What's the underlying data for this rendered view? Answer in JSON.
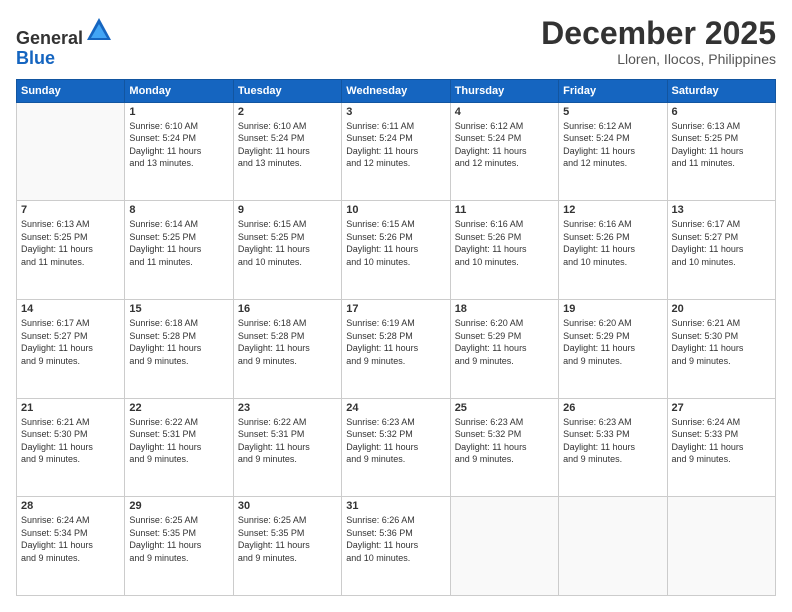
{
  "header": {
    "logo_general": "General",
    "logo_blue": "Blue",
    "month_title": "December 2025",
    "location": "Lloren, Ilocos, Philippines"
  },
  "days_of_week": [
    "Sunday",
    "Monday",
    "Tuesday",
    "Wednesday",
    "Thursday",
    "Friday",
    "Saturday"
  ],
  "weeks": [
    [
      {
        "day": "",
        "sunrise": "",
        "sunset": "",
        "daylight": ""
      },
      {
        "day": "1",
        "sunrise": "Sunrise: 6:10 AM",
        "sunset": "Sunset: 5:24 PM",
        "daylight": "Daylight: 11 hours and 13 minutes."
      },
      {
        "day": "2",
        "sunrise": "Sunrise: 6:10 AM",
        "sunset": "Sunset: 5:24 PM",
        "daylight": "Daylight: 11 hours and 13 minutes."
      },
      {
        "day": "3",
        "sunrise": "Sunrise: 6:11 AM",
        "sunset": "Sunset: 5:24 PM",
        "daylight": "Daylight: 11 hours and 12 minutes."
      },
      {
        "day": "4",
        "sunrise": "Sunrise: 6:12 AM",
        "sunset": "Sunset: 5:24 PM",
        "daylight": "Daylight: 11 hours and 12 minutes."
      },
      {
        "day": "5",
        "sunrise": "Sunrise: 6:12 AM",
        "sunset": "Sunset: 5:24 PM",
        "daylight": "Daylight: 11 hours and 12 minutes."
      },
      {
        "day": "6",
        "sunrise": "Sunrise: 6:13 AM",
        "sunset": "Sunset: 5:25 PM",
        "daylight": "Daylight: 11 hours and 11 minutes."
      }
    ],
    [
      {
        "day": "7",
        "sunrise": "Sunrise: 6:13 AM",
        "sunset": "Sunset: 5:25 PM",
        "daylight": "Daylight: 11 hours and 11 minutes."
      },
      {
        "day": "8",
        "sunrise": "Sunrise: 6:14 AM",
        "sunset": "Sunset: 5:25 PM",
        "daylight": "Daylight: 11 hours and 11 minutes."
      },
      {
        "day": "9",
        "sunrise": "Sunrise: 6:15 AM",
        "sunset": "Sunset: 5:25 PM",
        "daylight": "Daylight: 11 hours and 10 minutes."
      },
      {
        "day": "10",
        "sunrise": "Sunrise: 6:15 AM",
        "sunset": "Sunset: 5:26 PM",
        "daylight": "Daylight: 11 hours and 10 minutes."
      },
      {
        "day": "11",
        "sunrise": "Sunrise: 6:16 AM",
        "sunset": "Sunset: 5:26 PM",
        "daylight": "Daylight: 11 hours and 10 minutes."
      },
      {
        "day": "12",
        "sunrise": "Sunrise: 6:16 AM",
        "sunset": "Sunset: 5:26 PM",
        "daylight": "Daylight: 11 hours and 10 minutes."
      },
      {
        "day": "13",
        "sunrise": "Sunrise: 6:17 AM",
        "sunset": "Sunset: 5:27 PM",
        "daylight": "Daylight: 11 hours and 10 minutes."
      }
    ],
    [
      {
        "day": "14",
        "sunrise": "Sunrise: 6:17 AM",
        "sunset": "Sunset: 5:27 PM",
        "daylight": "Daylight: 11 hours and 9 minutes."
      },
      {
        "day": "15",
        "sunrise": "Sunrise: 6:18 AM",
        "sunset": "Sunset: 5:28 PM",
        "daylight": "Daylight: 11 hours and 9 minutes."
      },
      {
        "day": "16",
        "sunrise": "Sunrise: 6:18 AM",
        "sunset": "Sunset: 5:28 PM",
        "daylight": "Daylight: 11 hours and 9 minutes."
      },
      {
        "day": "17",
        "sunrise": "Sunrise: 6:19 AM",
        "sunset": "Sunset: 5:28 PM",
        "daylight": "Daylight: 11 hours and 9 minutes."
      },
      {
        "day": "18",
        "sunrise": "Sunrise: 6:20 AM",
        "sunset": "Sunset: 5:29 PM",
        "daylight": "Daylight: 11 hours and 9 minutes."
      },
      {
        "day": "19",
        "sunrise": "Sunrise: 6:20 AM",
        "sunset": "Sunset: 5:29 PM",
        "daylight": "Daylight: 11 hours and 9 minutes."
      },
      {
        "day": "20",
        "sunrise": "Sunrise: 6:21 AM",
        "sunset": "Sunset: 5:30 PM",
        "daylight": "Daylight: 11 hours and 9 minutes."
      }
    ],
    [
      {
        "day": "21",
        "sunrise": "Sunrise: 6:21 AM",
        "sunset": "Sunset: 5:30 PM",
        "daylight": "Daylight: 11 hours and 9 minutes."
      },
      {
        "day": "22",
        "sunrise": "Sunrise: 6:22 AM",
        "sunset": "Sunset: 5:31 PM",
        "daylight": "Daylight: 11 hours and 9 minutes."
      },
      {
        "day": "23",
        "sunrise": "Sunrise: 6:22 AM",
        "sunset": "Sunset: 5:31 PM",
        "daylight": "Daylight: 11 hours and 9 minutes."
      },
      {
        "day": "24",
        "sunrise": "Sunrise: 6:23 AM",
        "sunset": "Sunset: 5:32 PM",
        "daylight": "Daylight: 11 hours and 9 minutes."
      },
      {
        "day": "25",
        "sunrise": "Sunrise: 6:23 AM",
        "sunset": "Sunset: 5:32 PM",
        "daylight": "Daylight: 11 hours and 9 minutes."
      },
      {
        "day": "26",
        "sunrise": "Sunrise: 6:23 AM",
        "sunset": "Sunset: 5:33 PM",
        "daylight": "Daylight: 11 hours and 9 minutes."
      },
      {
        "day": "27",
        "sunrise": "Sunrise: 6:24 AM",
        "sunset": "Sunset: 5:33 PM",
        "daylight": "Daylight: 11 hours and 9 minutes."
      }
    ],
    [
      {
        "day": "28",
        "sunrise": "Sunrise: 6:24 AM",
        "sunset": "Sunset: 5:34 PM",
        "daylight": "Daylight: 11 hours and 9 minutes."
      },
      {
        "day": "29",
        "sunrise": "Sunrise: 6:25 AM",
        "sunset": "Sunset: 5:35 PM",
        "daylight": "Daylight: 11 hours and 9 minutes."
      },
      {
        "day": "30",
        "sunrise": "Sunrise: 6:25 AM",
        "sunset": "Sunset: 5:35 PM",
        "daylight": "Daylight: 11 hours and 9 minutes."
      },
      {
        "day": "31",
        "sunrise": "Sunrise: 6:26 AM",
        "sunset": "Sunset: 5:36 PM",
        "daylight": "Daylight: 11 hours and 10 minutes."
      },
      {
        "day": "",
        "sunrise": "",
        "sunset": "",
        "daylight": ""
      },
      {
        "day": "",
        "sunrise": "",
        "sunset": "",
        "daylight": ""
      },
      {
        "day": "",
        "sunrise": "",
        "sunset": "",
        "daylight": ""
      }
    ]
  ]
}
